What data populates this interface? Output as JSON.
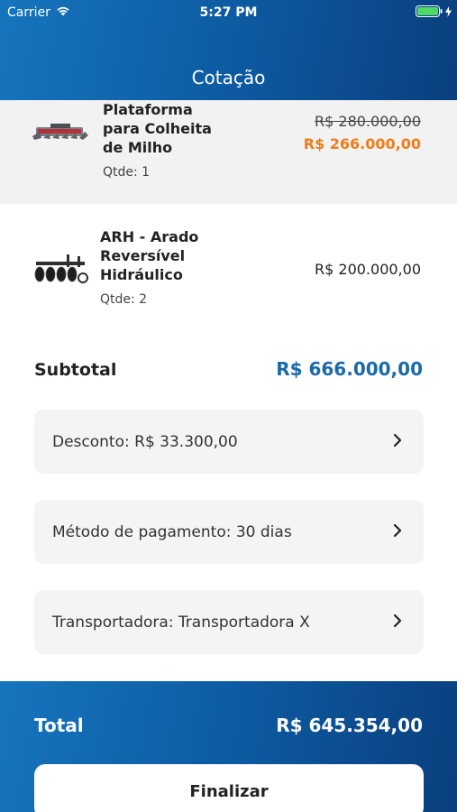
{
  "status_bar": {
    "carrier": "Carrier",
    "time": "5:27 PM"
  },
  "header": {
    "title": "Cotação"
  },
  "items": [
    {
      "name": "Plataforma para Colheita de Milho",
      "qty": "Qtde: 1",
      "price_old": "R$ 280.000,00",
      "price_new": "R$ 266.000,00",
      "image_icon": "corn-header-platform-image"
    },
    {
      "name": "ARH - Arado Reversível Hidráulico",
      "qty": "Qtde: 2",
      "price": "R$ 200.000,00",
      "image_icon": "disc-plow-image"
    }
  ],
  "subtotal": {
    "label": "Subtotal",
    "value": "R$ 666.000,00"
  },
  "options": [
    {
      "label": "Desconto: R$ 33.300,00"
    },
    {
      "label": "Método de pagamento: 30 dias"
    },
    {
      "label": "Transportadora: Transportadora X"
    }
  ],
  "footer": {
    "total_label": "Total",
    "total_value": "R$ 645.354,00",
    "finish_label": "Finalizar"
  },
  "colors": {
    "header_gradient_start": "#1675bd",
    "header_gradient_end": "#0a3f7e",
    "discount_price": "#ef7d19",
    "subtotal_value": "#1a6aa9",
    "battery": "#4cd964"
  }
}
